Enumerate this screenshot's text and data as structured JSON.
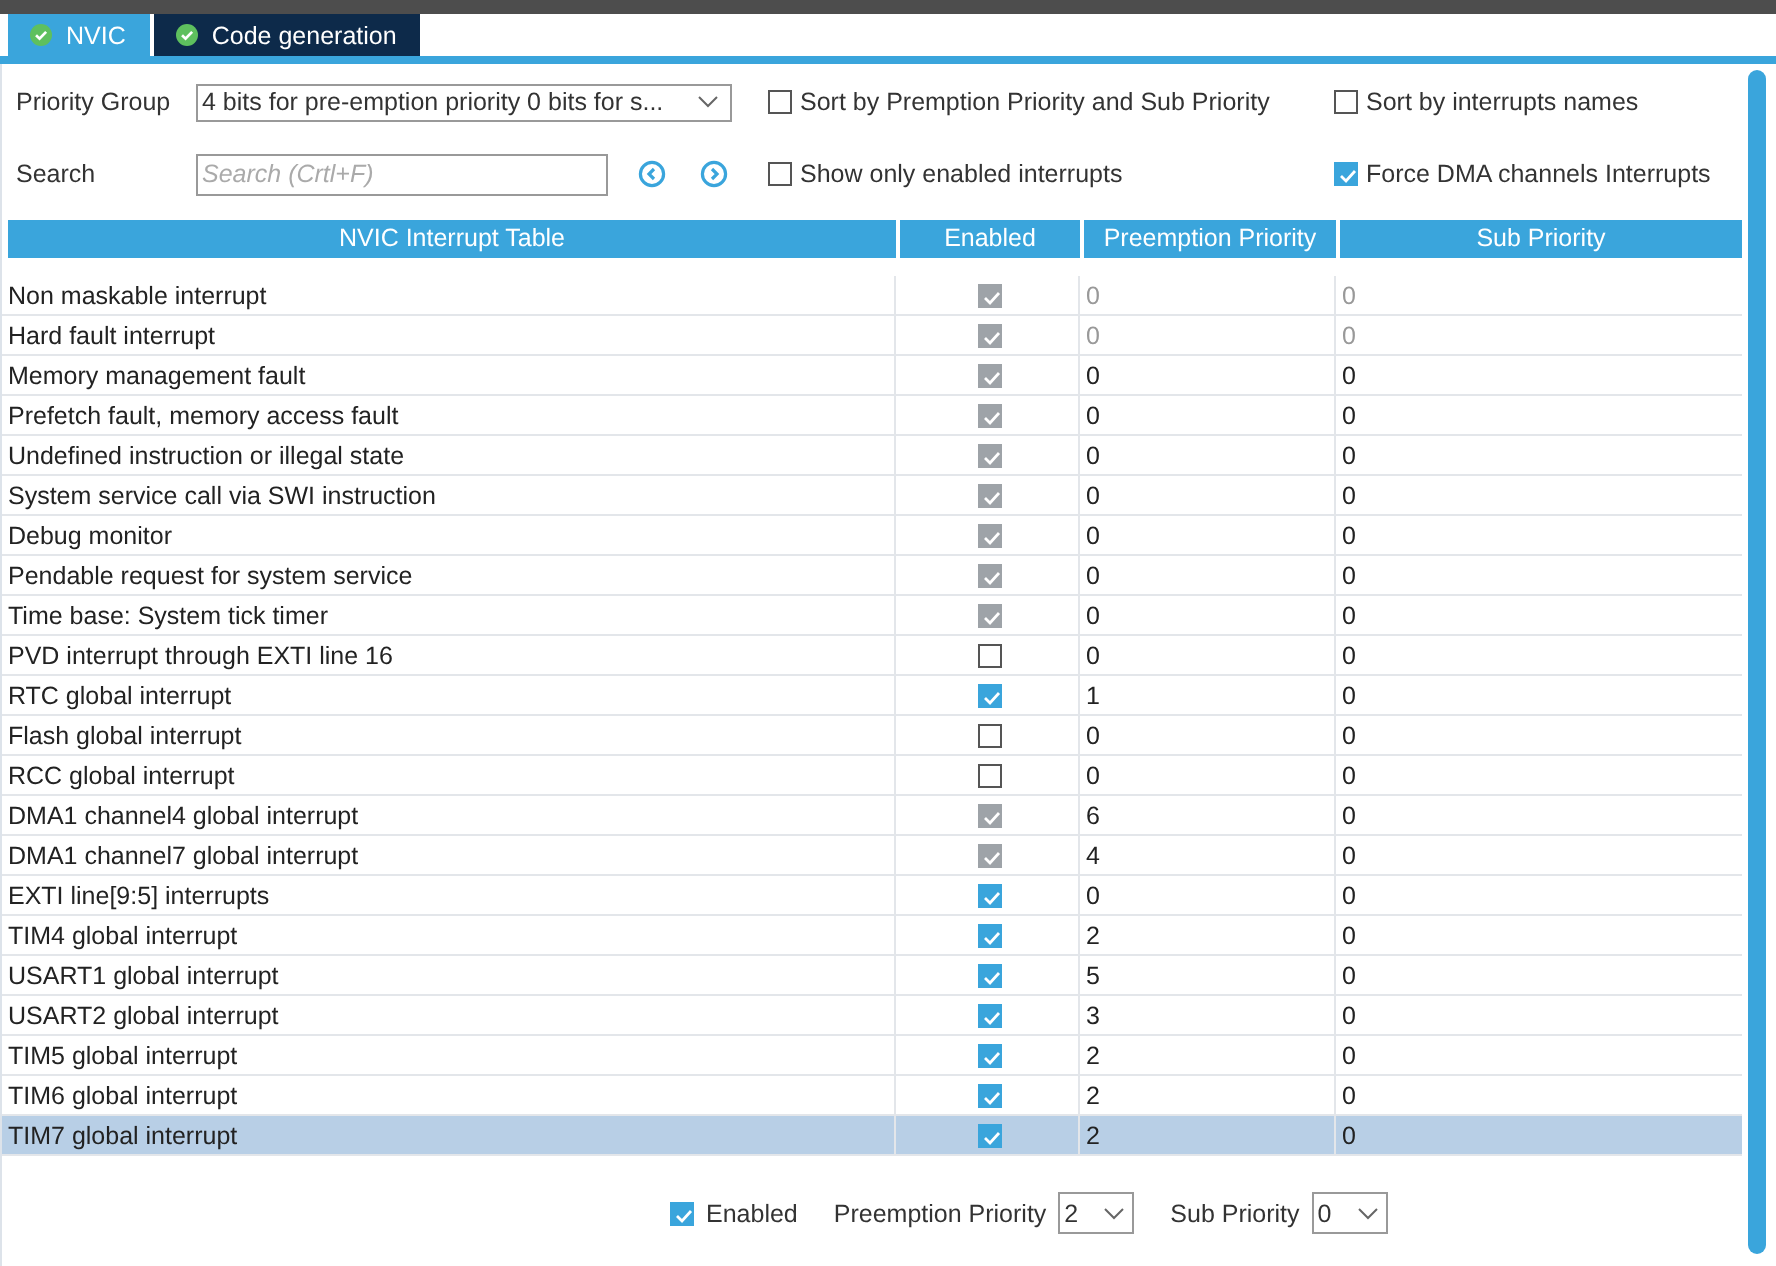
{
  "tabs": [
    {
      "label": "NVIC",
      "selected": true
    },
    {
      "label": "Code generation",
      "selected": false
    }
  ],
  "priority_group": {
    "label": "Priority Group",
    "value": "4 bits for pre-emption priority 0 bits for s..."
  },
  "search": {
    "label": "Search",
    "placeholder": "Search (Crtl+F)"
  },
  "options": [
    {
      "label": "Sort by Premption Priority and Sub Priority",
      "checked": false
    },
    {
      "label": "Sort by interrupts names",
      "checked": false
    },
    {
      "label": "Show only enabled interrupts",
      "checked": false
    },
    {
      "label": "Force DMA channels Interrupts",
      "checked": true
    }
  ],
  "table": {
    "columns": [
      "NVIC Interrupt Table",
      "Enabled",
      "Preemption Priority",
      "Sub Priority"
    ],
    "rows": [
      {
        "name": "Non maskable interrupt",
        "enabled": true,
        "disabled": true,
        "dimmed": true,
        "preemption": "0",
        "sub": "0",
        "selected": false
      },
      {
        "name": "Hard fault interrupt",
        "enabled": true,
        "disabled": true,
        "dimmed": true,
        "preemption": "0",
        "sub": "0",
        "selected": false
      },
      {
        "name": "Memory management fault",
        "enabled": true,
        "disabled": true,
        "dimmed": false,
        "preemption": "0",
        "sub": "0",
        "selected": false
      },
      {
        "name": "Prefetch fault, memory access fault",
        "enabled": true,
        "disabled": true,
        "dimmed": false,
        "preemption": "0",
        "sub": "0",
        "selected": false
      },
      {
        "name": "Undefined instruction or illegal state",
        "enabled": true,
        "disabled": true,
        "dimmed": false,
        "preemption": "0",
        "sub": "0",
        "selected": false
      },
      {
        "name": "System service call via SWI instruction",
        "enabled": true,
        "disabled": true,
        "dimmed": false,
        "preemption": "0",
        "sub": "0",
        "selected": false
      },
      {
        "name": "Debug monitor",
        "enabled": true,
        "disabled": true,
        "dimmed": false,
        "preemption": "0",
        "sub": "0",
        "selected": false
      },
      {
        "name": "Pendable request for system service",
        "enabled": true,
        "disabled": true,
        "dimmed": false,
        "preemption": "0",
        "sub": "0",
        "selected": false
      },
      {
        "name": "Time base: System tick timer",
        "enabled": true,
        "disabled": true,
        "dimmed": false,
        "preemption": "0",
        "sub": "0",
        "selected": false
      },
      {
        "name": "PVD interrupt through EXTI line 16",
        "enabled": false,
        "disabled": false,
        "dimmed": false,
        "preemption": "0",
        "sub": "0",
        "selected": false
      },
      {
        "name": "RTC global interrupt",
        "enabled": true,
        "disabled": false,
        "dimmed": false,
        "preemption": "1",
        "sub": "0",
        "selected": false
      },
      {
        "name": "Flash global interrupt",
        "enabled": false,
        "disabled": false,
        "dimmed": false,
        "preemption": "0",
        "sub": "0",
        "selected": false
      },
      {
        "name": "RCC global interrupt",
        "enabled": false,
        "disabled": false,
        "dimmed": false,
        "preemption": "0",
        "sub": "0",
        "selected": false
      },
      {
        "name": "DMA1 channel4 global interrupt",
        "enabled": true,
        "disabled": true,
        "dimmed": false,
        "preemption": "6",
        "sub": "0",
        "selected": false
      },
      {
        "name": "DMA1 channel7 global interrupt",
        "enabled": true,
        "disabled": true,
        "dimmed": false,
        "preemption": "4",
        "sub": "0",
        "selected": false
      },
      {
        "name": "EXTI line[9:5] interrupts",
        "enabled": true,
        "disabled": false,
        "dimmed": false,
        "preemption": "0",
        "sub": "0",
        "selected": false
      },
      {
        "name": "TIM4 global interrupt",
        "enabled": true,
        "disabled": false,
        "dimmed": false,
        "preemption": "2",
        "sub": "0",
        "selected": false
      },
      {
        "name": "USART1 global interrupt",
        "enabled": true,
        "disabled": false,
        "dimmed": false,
        "preemption": "5",
        "sub": "0",
        "selected": false
      },
      {
        "name": "USART2 global interrupt",
        "enabled": true,
        "disabled": false,
        "dimmed": false,
        "preemption": "3",
        "sub": "0",
        "selected": false
      },
      {
        "name": "TIM5 global interrupt",
        "enabled": true,
        "disabled": false,
        "dimmed": false,
        "preemption": "2",
        "sub": "0",
        "selected": false
      },
      {
        "name": "TIM6 global interrupt",
        "enabled": true,
        "disabled": false,
        "dimmed": false,
        "preemption": "2",
        "sub": "0",
        "selected": false
      },
      {
        "name": "TIM7 global interrupt",
        "enabled": true,
        "disabled": false,
        "dimmed": false,
        "preemption": "2",
        "sub": "0",
        "selected": true
      }
    ]
  },
  "footer": {
    "enabled": {
      "label": "Enabled",
      "checked": true
    },
    "preemption": {
      "label": "Preemption Priority",
      "value": "2"
    },
    "sub": {
      "label": "Sub Priority",
      "value": "0"
    }
  }
}
